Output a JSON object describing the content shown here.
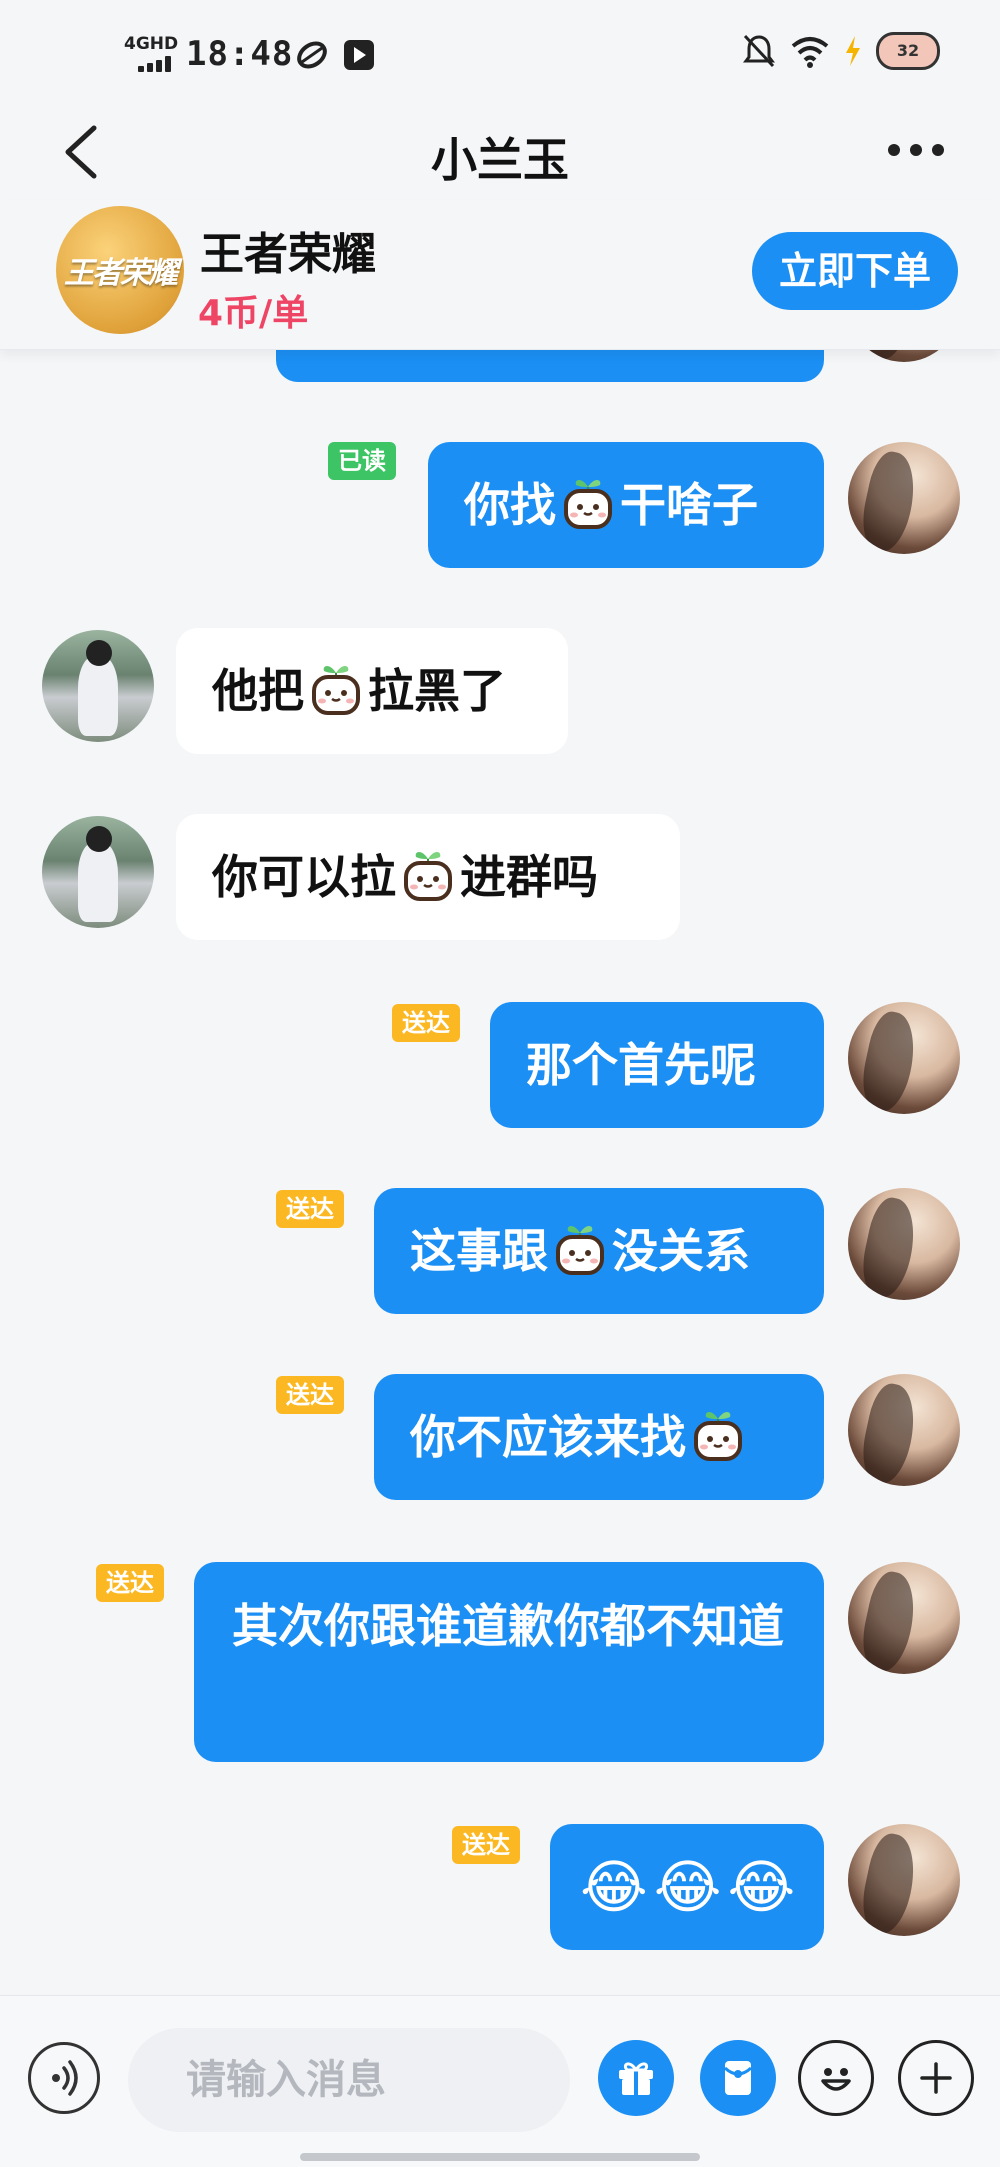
{
  "status_bar": {
    "network": "4GHD",
    "time": "18:48",
    "battery": "32"
  },
  "header": {
    "back_icon": "chevron-left-icon",
    "title": "小兰玉",
    "more_icon": "more-dots-icon"
  },
  "service": {
    "logo_text": "王者荣耀",
    "game_name": "王者荣耀",
    "price": "4币/单",
    "order_button": "立即下单"
  },
  "messages": [
    {
      "side": "me",
      "status": "已读",
      "parts": [
        "你找",
        "[pet]",
        "干啥子"
      ]
    },
    {
      "side": "them",
      "parts": [
        "他把",
        "[pet]",
        "拉黑了"
      ]
    },
    {
      "side": "them",
      "parts": [
        "你可以拉",
        "[pet]",
        "进群吗"
      ]
    },
    {
      "side": "me",
      "status": "送达",
      "parts": [
        "那个首先呢"
      ]
    },
    {
      "side": "me",
      "status": "送达",
      "parts": [
        "这事跟",
        "[pet]",
        "没关系"
      ]
    },
    {
      "side": "me",
      "status": "送达",
      "parts": [
        "你不应该来找",
        "[pet]"
      ]
    },
    {
      "side": "me",
      "status": "送达",
      "parts": [
        "其次你跟谁道歉你都不知道"
      ]
    },
    {
      "side": "me",
      "status": "送达",
      "parts": [
        "😂😂😂"
      ]
    }
  ],
  "input_bar": {
    "placeholder": "请输入消息",
    "icons": [
      "voice-icon",
      "gift-icon",
      "red-packet-icon",
      "emoji-icon",
      "plus-icon"
    ]
  },
  "colors": {
    "accent": "#1b8ff3",
    "price": "#ef4565",
    "read_tag": "#3dc464",
    "sent_tag": "#fbb823"
  }
}
